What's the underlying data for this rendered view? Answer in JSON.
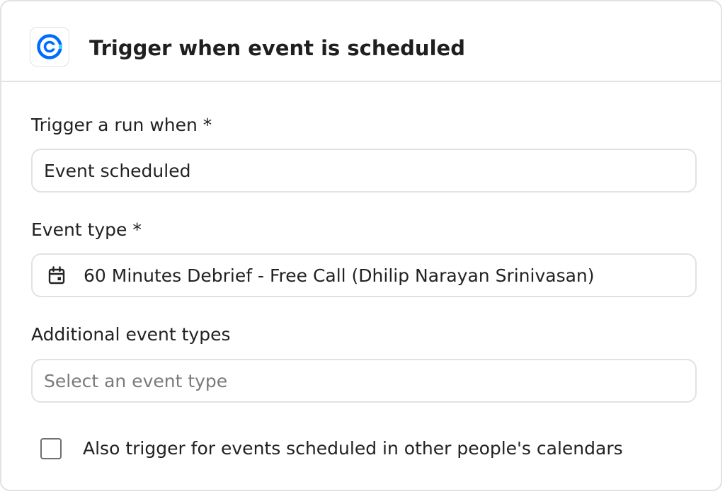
{
  "header": {
    "title": "Trigger when event is scheduled",
    "logo_icon": "calendly-logo-icon",
    "brand_color": "#006BFF"
  },
  "fields": {
    "trigger": {
      "label": "Trigger a run when *",
      "value": "Event scheduled"
    },
    "event_type": {
      "label": "Event type *",
      "icon": "calendar-icon",
      "value": "60 Minutes Debrief - Free Call (Dhilip Narayan Srinivasan)"
    },
    "additional_event_types": {
      "label": "Additional event types",
      "placeholder": "Select an event type"
    }
  },
  "checkbox": {
    "label": "Also trigger for events scheduled in other people's calendars",
    "checked": false
  }
}
